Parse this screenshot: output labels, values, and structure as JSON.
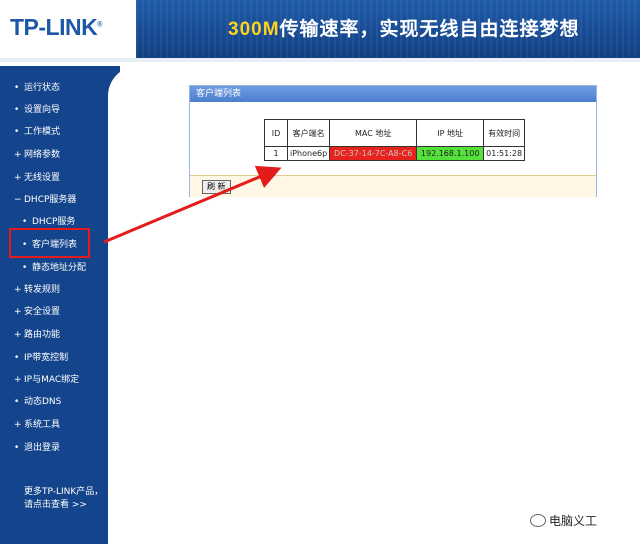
{
  "header": {
    "logo": "TP-LINK",
    "logo_mark": "®",
    "banner_highlight": "300M",
    "banner_text": "传输速率，实现无线自由连接梦想"
  },
  "sidebar": {
    "items": [
      {
        "label": "运行状态"
      },
      {
        "label": "设置向导"
      },
      {
        "label": "工作模式"
      },
      {
        "label": "网络参数"
      },
      {
        "label": "无线设置"
      },
      {
        "label": "DHCP服务器"
      },
      {
        "label": "DHCP服务"
      },
      {
        "label": "客户端列表"
      },
      {
        "label": "静态地址分配"
      },
      {
        "label": "转发规则"
      },
      {
        "label": "安全设置"
      },
      {
        "label": "路由功能"
      },
      {
        "label": "IP带宽控制"
      },
      {
        "label": "IP与MAC绑定"
      },
      {
        "label": "动态DNS"
      },
      {
        "label": "系统工具"
      },
      {
        "label": "退出登录"
      }
    ],
    "more_line1": "更多TP-LINK产品，",
    "more_line2": "请点击查看 >>"
  },
  "panel": {
    "title": "客户端列表",
    "headers": [
      "ID",
      "客户端名",
      "MAC 地址",
      "IP 地址",
      "有效时间"
    ],
    "rows": [
      {
        "id": "1",
        "name": "iPhone6p",
        "mac": "DC-37-14-7C-A8-C6",
        "ip": "192.168.1.100",
        "lease": "01:51:28"
      }
    ],
    "refresh_label": "刷 新"
  },
  "watermark": "电脑义工",
  "colors": {
    "sidebar_bg": "#14458c",
    "highlight_box": "#e41b1b",
    "mac_highlight": "#e8221d",
    "ip_highlight": "#54e23a"
  }
}
